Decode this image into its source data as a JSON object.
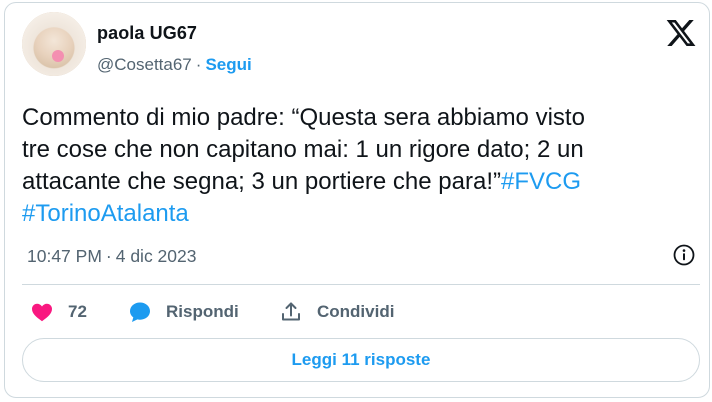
{
  "author": {
    "name": "paola UG67",
    "handle": "@Cosetta67",
    "separator": "·",
    "follow_label": "Segui"
  },
  "tweet": {
    "text_line1": "Commento di mio padre: “Questa sera abbiamo visto",
    "text_line2": "tre cose che non capitano mai: 1 un rigore dato; 2 un",
    "text_line3": "attacante che segna; 3 un portiere che para!”",
    "hashtag1": "#FVCG",
    "hashtag2": "#TorinoAtalanta",
    "time": "10:47 PM",
    "separator": "·",
    "date": "4 dic 2023"
  },
  "actions": {
    "like_count": "72",
    "reply_label": "Rispondi",
    "share_label": "Condividi"
  },
  "read_replies_label": "Leggi 11 risposte",
  "colors": {
    "accent": "#1d9bf0",
    "like": "#f91880",
    "secondary_text": "#536471",
    "border": "#cfd9de"
  },
  "icons": {
    "brand": "x-logo-icon",
    "info": "info-icon",
    "like": "heart-icon",
    "reply": "speech-bubble-icon",
    "share": "share-icon"
  }
}
